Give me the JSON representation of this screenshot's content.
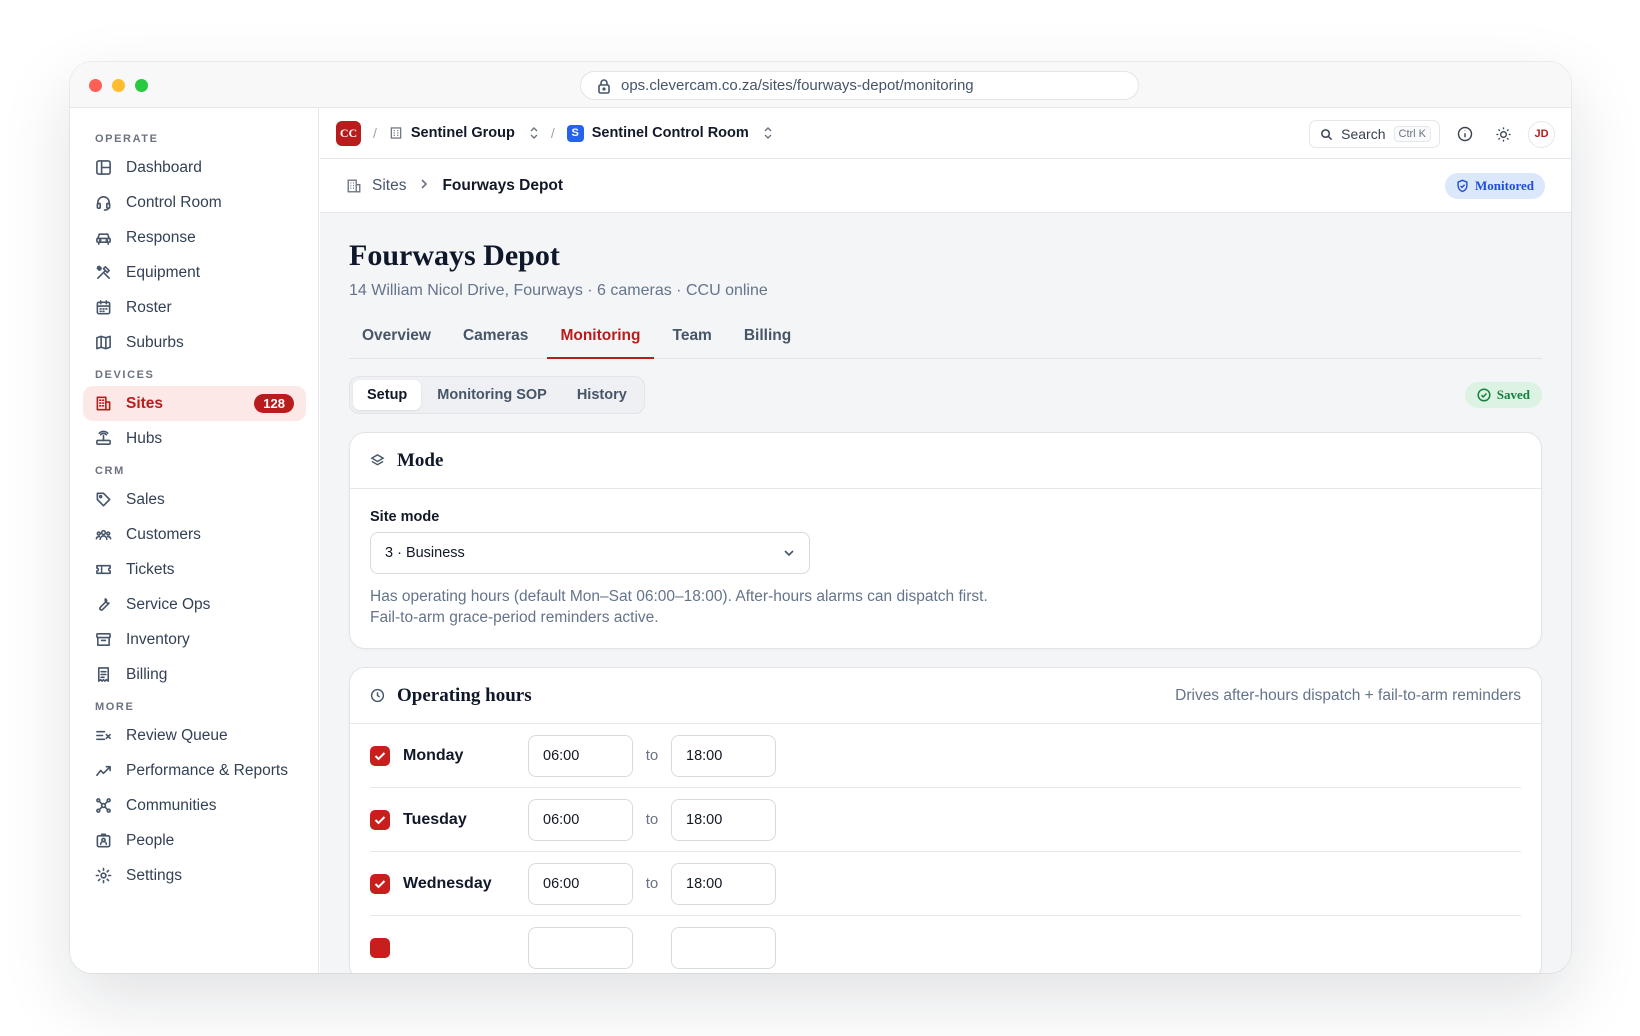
{
  "browser": {
    "url": "ops.clevercam.co.za/sites/fourways-depot/monitoring"
  },
  "sidebar": {
    "sections": [
      {
        "title": "OPERATE",
        "items": [
          {
            "label": "Dashboard",
            "icon": "layout-icon"
          },
          {
            "label": "Control Room",
            "icon": "headset-icon"
          },
          {
            "label": "Response",
            "icon": "car-icon"
          },
          {
            "label": "Equipment",
            "icon": "tools-icon"
          },
          {
            "label": "Roster",
            "icon": "calendar-icon"
          },
          {
            "label": "Suburbs",
            "icon": "map-icon"
          }
        ]
      },
      {
        "title": "DEVICES",
        "items": [
          {
            "label": "Sites",
            "icon": "building-icon",
            "badge": "128",
            "active": true
          },
          {
            "label": "Hubs",
            "icon": "router-icon"
          }
        ]
      },
      {
        "title": "CRM",
        "items": [
          {
            "label": "Sales",
            "icon": "tag-icon"
          },
          {
            "label": "Customers",
            "icon": "users-icon"
          },
          {
            "label": "Tickets",
            "icon": "ticket-icon"
          },
          {
            "label": "Service Ops",
            "icon": "wrench-icon"
          },
          {
            "label": "Inventory",
            "icon": "archive-icon"
          },
          {
            "label": "Billing",
            "icon": "receipt-icon"
          }
        ]
      },
      {
        "title": "MORE",
        "items": [
          {
            "label": "Review Queue",
            "icon": "list-x-icon"
          },
          {
            "label": "Performance & Reports",
            "icon": "trend-icon"
          },
          {
            "label": "Communities",
            "icon": "network-icon"
          },
          {
            "label": "People",
            "icon": "id-badge-icon"
          },
          {
            "label": "Settings",
            "icon": "gear-icon"
          }
        ]
      }
    ]
  },
  "topbar": {
    "logo": "CC",
    "org": "Sentinel Group",
    "room_logo": "S",
    "room": "Sentinel Control Room",
    "search_label": "Search",
    "search_shortcut": "Ctrl K",
    "avatar": "JD"
  },
  "breadcrumb": {
    "parent": "Sites",
    "current": "Fourways Depot",
    "status": "Monitored"
  },
  "page": {
    "title": "Fourways Depot",
    "subtitle": "14 William Nicol Drive, Fourways · 6 cameras · CCU online",
    "tabs": [
      "Overview",
      "Cameras",
      "Monitoring",
      "Team",
      "Billing"
    ],
    "active_tab": "Monitoring",
    "subtabs": [
      "Setup",
      "Monitoring SOP",
      "History"
    ],
    "active_subtab": "Setup",
    "save_status": "Saved"
  },
  "mode_card": {
    "title": "Mode",
    "field_label": "Site mode",
    "selected": "3 · Business",
    "help": "Has operating hours (default Mon–Sat 06:00–18:00). After-hours alarms can dispatch first. Fail-to-arm grace-period reminders active."
  },
  "hours_card": {
    "title": "Operating hours",
    "note": "Drives after-hours dispatch + fail-to-arm reminders",
    "to_label": "to",
    "days": [
      {
        "day": "Monday",
        "open": "06:00",
        "close": "18:00",
        "enabled": true
      },
      {
        "day": "Tuesday",
        "open": "06:00",
        "close": "18:00",
        "enabled": true
      },
      {
        "day": "Wednesday",
        "open": "06:00",
        "close": "18:00",
        "enabled": true
      }
    ]
  },
  "colors": {
    "accent": "#b91c1c",
    "active_bg": "#fde8e8",
    "monitored_bg": "#dbe7fb",
    "saved_bg": "#dcf3e4"
  }
}
